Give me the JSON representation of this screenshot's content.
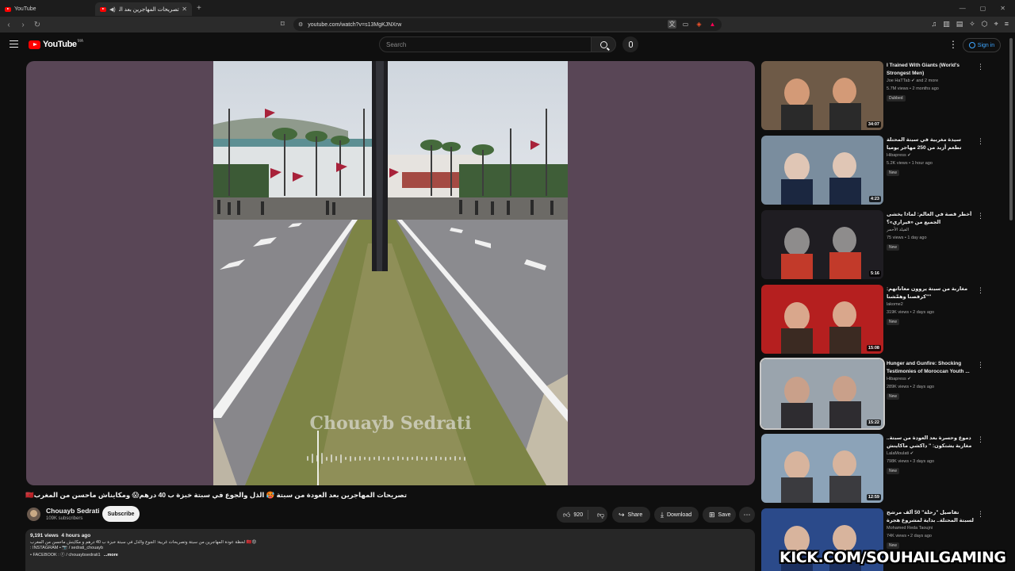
{
  "browser": {
    "tabs": [
      {
        "label": "YouTube"
      },
      {
        "label": "تصريحات المهاجرين بعد العودة"
      }
    ],
    "url": "youtube.com/watch?v=s13MgKJNXrw"
  },
  "header": {
    "logo": "YouTube",
    "country": "MA",
    "search_placeholder": "Search",
    "signin_label": "Sign in"
  },
  "video": {
    "watermark": "Chouayb Sedrati",
    "title": "تصريحات المهاجرين بعد العودة من سبتة 🥵 الذل والجوع في سبتة خبزة ب 40 درهم😱 ومكايناش ماحسن من المغرب🇲🇦",
    "channel": "Chouayb Sedrati",
    "subscribers": "109K subscribers",
    "subscribe_label": "Subscribe",
    "likes": "920",
    "share_label": "Share",
    "download_label": "Download",
    "save_label": "Save",
    "views": "9,191 views",
    "uploaded": "4 hours ago",
    "desc_lines": [
      "لحظة عودة المهاجرين من سبتة وتصريحات غريبة: الجوع والذل في سبتة خبزة ب 40 درهم و مكاينش ماحسن من المغرب 🇲🇦😡",
      ": INSTAGRAM • 📷 / sedrati_chouayb",
      "• FACEBOOK : ⓕ / chouaybsedrati1"
    ],
    "more_label": "...more"
  },
  "sidebar": [
    {
      "title": "I Trained With Giants (World's Strongest Men)",
      "channel": "Joe HaTTab ✔ and 2 more",
      "stats": "5.7M views • 2 months ago",
      "badge": "Dubbed",
      "duration": "34:07"
    },
    {
      "title": "سيدة مغربية في سبتة المحتلة تطعم أزيد من 250 مهاجر يوميا وتكشف تفاصيل مثيرة",
      "channel": "Hibapress ✔",
      "stats": "5.2K views • 1 hour ago",
      "badge": "New",
      "duration": "4:23"
    },
    {
      "title": "أخطر قصة في العالم: لماذا يخشى الجميع من «فيراري»؟",
      "channel": "الفيلد الأحمر",
      "stats": "75 views • 1 day ago",
      "badge": "New",
      "duration": "5:16"
    },
    {
      "title": "مغاربة من سبتة يروون معاناتهم: \"كرفصنا وهمّشنا\"",
      "channel": "lakome2",
      "stats": "319K views • 2 days ago",
      "badge": "New",
      "duration": "15:08"
    },
    {
      "title": "Hunger and Gunfire: Shocking Testimonies of Moroccan Youth ...",
      "channel": "Hibapress ✔",
      "stats": "289K views • 2 days ago",
      "badge": "New",
      "duration": "15:22"
    },
    {
      "title": "دموع وحسرة بعد العودة من سبتة.. مغاربة يشتكون: \" داكشي ماكاينش ماكلة \"",
      "channel": "LalaMoulati ✔",
      "stats": "798K views • 3 days ago",
      "badge": "New",
      "duration": "12:59"
    },
    {
      "title": "تفاصيل \"رحلة\" 50 ألف مرشح لسبتة المحتلة.. بداية لمشروع هجرة",
      "channel": "Mohamed Reda Taoujni",
      "stats": "74K views • 2 days ago",
      "badge": "New",
      "duration": ""
    }
  ],
  "overlay": {
    "text": "KICK.COM/SOUHAILGAMING"
  }
}
